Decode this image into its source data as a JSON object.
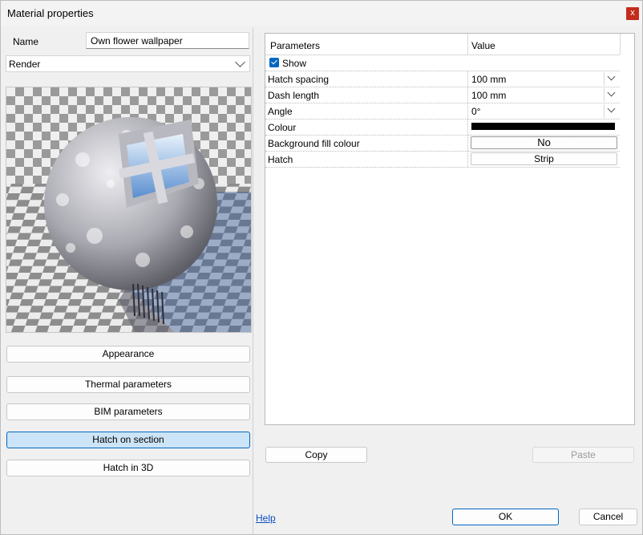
{
  "window": {
    "title": "Material properties",
    "close_glyph": "x"
  },
  "material": {
    "name_label": "Name",
    "name_value": "Own flower wallpaper",
    "render_mode": "Render"
  },
  "preview": {
    "description_icon": "material-sphere-preview"
  },
  "left_buttons": [
    {
      "label": "Appearance",
      "active": false
    },
    {
      "label": "Thermal parameters",
      "active": false
    },
    {
      "label": "BIM parameters",
      "active": false
    },
    {
      "label": "Hatch on section",
      "active": true
    },
    {
      "label": "Hatch in 3D",
      "active": false
    }
  ],
  "grid": {
    "col_params": "Parameters",
    "col_value": "Value",
    "show_label": "Show",
    "show_checked": true,
    "rows": [
      {
        "label": "Hatch spacing",
        "value": "100 mm"
      },
      {
        "label": "Dash length",
        "value": "100 mm"
      },
      {
        "label": "Angle",
        "value": "0°"
      },
      {
        "label": "Colour",
        "value": "#000000"
      },
      {
        "label": "Background fill colour",
        "value": "No"
      },
      {
        "label": "Hatch",
        "value": "Strip"
      }
    ]
  },
  "actions": {
    "copy": "Copy",
    "paste": "Paste",
    "help": "Help",
    "ok": "OK",
    "cancel": "Cancel"
  },
  "colors": {
    "accent": "#0067c0",
    "close": "#c42b1c",
    "active_button": "#cce4f7"
  }
}
